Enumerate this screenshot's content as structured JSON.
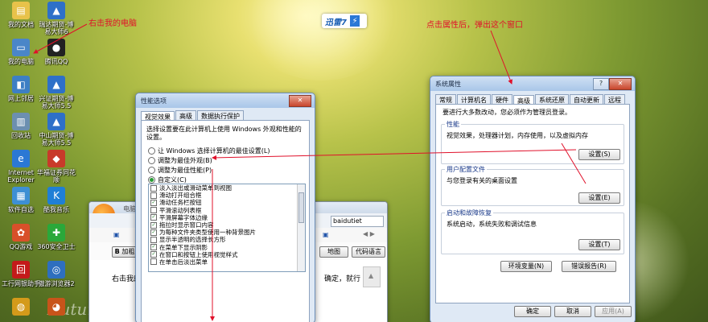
{
  "desktop": {
    "icons": [
      {
        "label": "我的文档",
        "glyph": "▤",
        "color": "#e8c24a"
      },
      {
        "label": "瑞达期货-博易大师6",
        "glyph": "▲",
        "color": "#2e70c8"
      },
      {
        "label": "我的电脑",
        "glyph": "▭",
        "color": "#4a86c8"
      },
      {
        "label": "腾讯QQ",
        "glyph": "●",
        "color": "#222222"
      },
      {
        "label": "网上邻居",
        "glyph": "◧",
        "color": "#3d7fc4"
      },
      {
        "label": "兴证期货-博易大师5.5",
        "glyph": "▲",
        "color": "#2e70c8"
      },
      {
        "label": "回收站",
        "glyph": "▥",
        "color": "#6c8fb0"
      },
      {
        "label": "中山期货-博易大师5.5",
        "glyph": "▲",
        "color": "#2e70c8"
      },
      {
        "label": "Internet Explorer",
        "glyph": "e",
        "color": "#2b78d4"
      },
      {
        "label": "华福证券同花顺",
        "glyph": "◆",
        "color": "#c83a2a"
      },
      {
        "label": "软件自选",
        "glyph": "▦",
        "color": "#3d8fd4"
      },
      {
        "label": "酷我音乐",
        "glyph": "K",
        "color": "#1f7fd6"
      },
      {
        "label": "QQ游戏",
        "glyph": "✿",
        "color": "#d8502a"
      },
      {
        "label": "360安全卫士",
        "glyph": "✚",
        "color": "#2aa83a"
      },
      {
        "label": "工行网银助手",
        "glyph": "回",
        "color": "#c41a1a"
      },
      {
        "label": "傲游浏览器2",
        "glyph": "◎",
        "color": "#2e6fbf"
      },
      {
        "label": "",
        "glyph": "◍",
        "color": "#d49a1a"
      },
      {
        "label": "",
        "glyph": "◕",
        "color": "#c8541a"
      }
    ],
    "logo_text": "迅雷7",
    "logo_badge": "⚡",
    "watermark": "Autumn"
  },
  "annotations": {
    "right_click": "右击我的电脑",
    "click_props": "点击属性后，弹出这个窗口"
  },
  "sysprops": {
    "title": "系统属性",
    "tabs": [
      "常规",
      "计算机名",
      "硬件",
      "高级",
      "系统还原",
      "自动更新",
      "远程"
    ],
    "notice": "要进行大多数改动，您必须作为管理员登录。",
    "groups": [
      {
        "title": "性能",
        "desc": "视觉效果，处理器计划，内存使用，以及虚拟内存",
        "button": "设置(S)"
      },
      {
        "title": "用户配置文件",
        "desc": "与您登录有关的桌面设置",
        "button": "设置(E)"
      },
      {
        "title": "启动和故障恢复",
        "desc": "系统启动，系统失败和调试信息",
        "button": "设置(T)"
      }
    ],
    "env_button": "环境变量(N)",
    "error_button": "错误报告(R)",
    "ok": "确定",
    "cancel": "取消",
    "apply": "应用(A)"
  },
  "perfopts": {
    "title": "性能选项",
    "tabs": [
      "视觉效果",
      "高级",
      "数据执行保护"
    ],
    "intro": "选择设置要在此计算机上使用 Windows 外观和性能的设置。",
    "radios": [
      {
        "label": "让 Windows 选择计算机的最佳设置(L)",
        "checked": false
      },
      {
        "label": "调整为最佳外观(B)",
        "checked": false
      },
      {
        "label": "调整为最佳性能(P)",
        "checked": false
      },
      {
        "label": "自定义(C)",
        "checked": true
      }
    ],
    "items": [
      {
        "label": "淡入淡出或滑动菜单到视图",
        "checked": false
      },
      {
        "label": "滑动打开组合框",
        "checked": false
      },
      {
        "label": "滑动任务栏按钮",
        "checked": true
      },
      {
        "label": "平滑滚动列表框",
        "checked": false
      },
      {
        "label": "平滑屏幕字体边缘",
        "checked": true
      },
      {
        "label": "拖拉时显示窗口内容",
        "checked": true
      },
      {
        "label": "为每种文件夹类型使用一种背景图片",
        "checked": true
      },
      {
        "label": "显示半透明的选择长方形",
        "checked": false
      },
      {
        "label": "在菜单下显示阴影",
        "checked": true
      },
      {
        "label": "在窗口和按钮上使用视觉样式",
        "checked": true
      },
      {
        "label": "在单击后淡出菜单",
        "checked": false
      }
    ]
  },
  "browser": {
    "title": "电脑上",
    "address": "baidutiet",
    "bold_btn": "B",
    "add_label": "加粗",
    "map_label": "地图",
    "code_label": "代码语言",
    "content_left": "右击我的",
    "content_right": "确定，就行"
  }
}
